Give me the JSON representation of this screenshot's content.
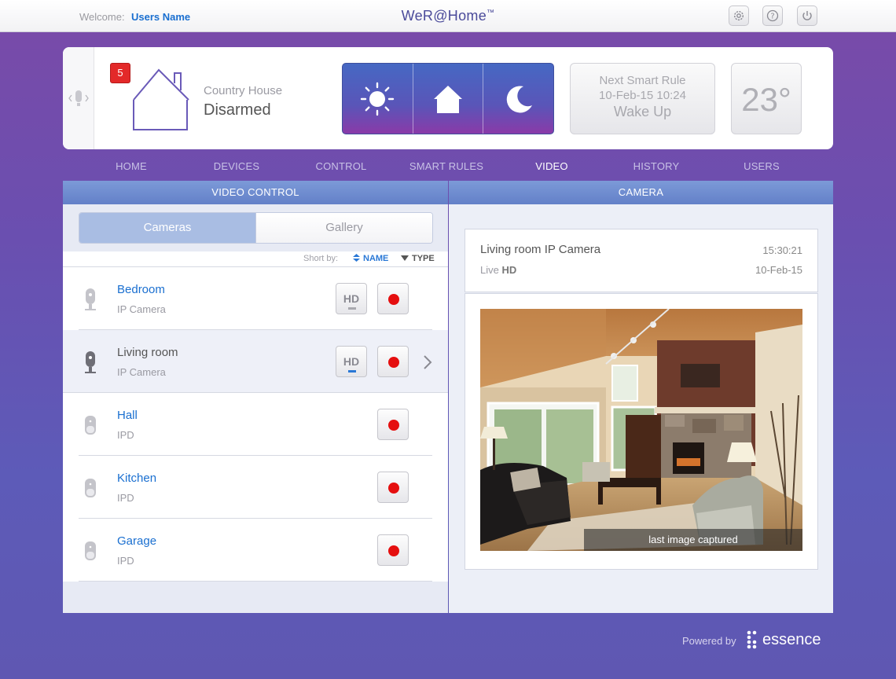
{
  "topbar": {
    "welcome_label": "Welcome:",
    "user_name": "Users Name",
    "app_title": "WeR@Home",
    "app_title_mark": "™",
    "icons": [
      "settings-icon",
      "help-icon",
      "power-icon"
    ]
  },
  "header": {
    "alert_count": "5",
    "location": "Country House",
    "arm_state": "Disarmed",
    "modes": [
      "day-mode-icon",
      "home-mode-icon",
      "night-mode-icon"
    ],
    "next_rule": {
      "title": "Next Smart Rule",
      "datetime": "10-Feb-15 10:24",
      "name": "Wake Up"
    },
    "temperature": "23°"
  },
  "nav": {
    "items": [
      "HOME",
      "DEVICES",
      "CONTROL",
      "SMART RULES",
      "VIDEO",
      "HISTORY",
      "USERS"
    ],
    "active": "VIDEO"
  },
  "video_control": {
    "title": "VIDEO CONTROL",
    "tabs": {
      "cameras": "Cameras",
      "gallery": "Gallery"
    },
    "sort": {
      "label": "Short by:",
      "name": "NAME",
      "type": "TYPE"
    },
    "devices": [
      {
        "name": "Bedroom",
        "type": "IP Camera",
        "hd": true,
        "hd_label": "HD",
        "hd_active": false,
        "selected": false
      },
      {
        "name": "Living room",
        "type": "IP Camera",
        "hd": true,
        "hd_label": "HD",
        "hd_active": true,
        "selected": true
      },
      {
        "name": "Hall",
        "type": "IPD",
        "hd": false,
        "selected": false
      },
      {
        "name": "Kitchen",
        "type": "IPD",
        "hd": false,
        "selected": false
      },
      {
        "name": "Garage",
        "type": "IPD",
        "hd": false,
        "selected": false
      }
    ]
  },
  "camera": {
    "title": "CAMERA",
    "name": "Living room IP Camera",
    "time": "15:30:21",
    "live_label": "Live",
    "quality": "HD",
    "date": "10-Feb-15",
    "caption": "last image captured"
  },
  "footer": {
    "powered_by": "Powered by",
    "brand": "essence"
  },
  "colors": {
    "accent_blue": "#1a6fd0",
    "record_red": "#e50f0f",
    "alert_red": "#e32929",
    "header_blue": "#7c9ad8"
  }
}
